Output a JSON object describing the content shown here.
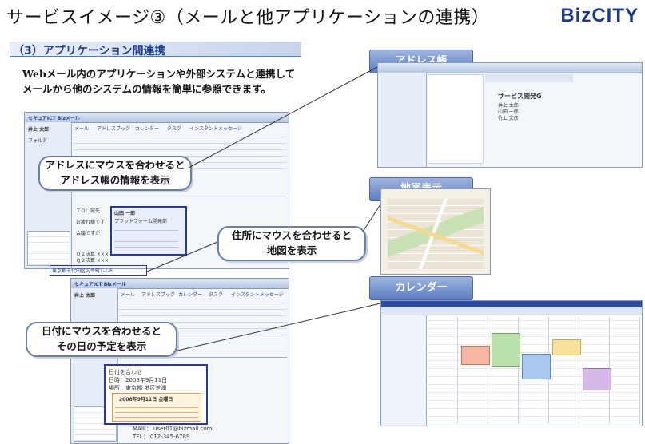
{
  "title": "サービスイメージ③（メールと他アプリケーションの連携）",
  "brand": "BizCITY",
  "section": {
    "heading": "（3）アプリケーション間連携"
  },
  "lead": {
    "line1": "Webメール内のアプリケーションや外部システムと連携して",
    "line2": "メールから他のシステムの情報を簡単に参照できます。"
  },
  "callouts": {
    "address": {
      "line1": "アドレスにマウスを合わせると",
      "line2": "アドレス帳の情報を表示"
    },
    "map": {
      "line1": "住所にマウスを合わせると",
      "line2": "地図を表示"
    },
    "date": {
      "line1": "日付にマウスを合わせると",
      "line2": "その日の予定を表示"
    }
  },
  "panels": {
    "address_book": "アドレス帳",
    "map": "地図表示",
    "calendar": "カレンダー"
  },
  "screenshot_top": {
    "app_name": "セキュアICT Bizメール",
    "user": "井上 太郎",
    "toolbar": [
      "メール",
      "アドレスブック",
      "カレンダー",
      "タスク",
      "インスタントメッセージ"
    ],
    "popup_name": "山田 一郎",
    "popup_company": "プラットフォーム開発部",
    "address_link": "東京都千代田区内幸町1-1-6",
    "mail_body": [
      "ＴＯ：宛先",
      "お疲れ様です",
      "会議ですが",
      "Ｑ１決算 ×××",
      "Ｑ２決算 ×××"
    ],
    "folder": "フォルダ"
  },
  "screenshot_bottom": {
    "app_name": "セキュアICT Bizメール",
    "user": "井上 太郎",
    "toolbar": [
      "メール",
      "アドレスブック",
      "カレンダー",
      "タスク",
      "インスタントメッセージ"
    ],
    "mail_subject": "日付を合わせ",
    "mail_date": "日時：2008年9月11日",
    "mail_place": "場所：東京都 港区芝浦",
    "calendar_date": "2008年9月11日 金曜日",
    "mail_line": "MAIL： user01@bizmail.com",
    "tel_line": "TEL： 012-345-6789"
  },
  "address_book_shot": {
    "contact_title": "サービス開発G",
    "entries": [
      "井上 太郎",
      "山田 一郎",
      "竹上 文彦"
    ]
  }
}
